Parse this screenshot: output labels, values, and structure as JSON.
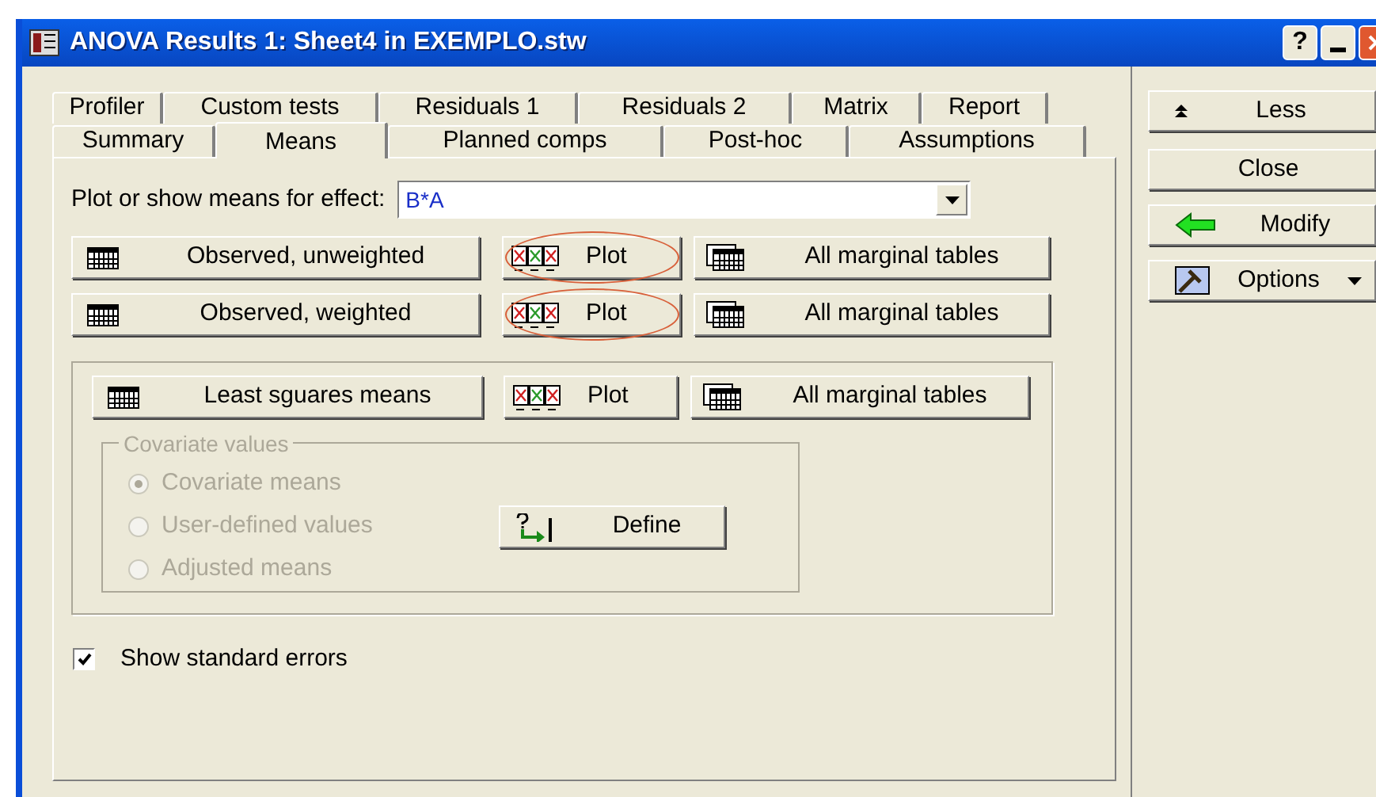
{
  "window": {
    "title": "ANOVA Results 1: Sheet4 in EXEMPLO.stw",
    "help_button": "?"
  },
  "tab_rows": [
    [
      {
        "label": "Profiler",
        "selected": false
      },
      {
        "label": "Custom tests",
        "selected": false
      },
      {
        "label": "Residuals 1",
        "selected": false
      },
      {
        "label": "Residuals 2",
        "selected": false
      },
      {
        "label": "Matrix",
        "selected": false
      },
      {
        "label": "Report",
        "selected": false
      }
    ],
    [
      {
        "label": "Summary",
        "selected": false
      },
      {
        "label": "Means",
        "selected": true
      },
      {
        "label": "Planned comps",
        "selected": false
      },
      {
        "label": "Post-hoc",
        "selected": false
      },
      {
        "label": "Assumptions",
        "selected": false
      }
    ]
  ],
  "effect": {
    "label": "Plot or show means for effect:",
    "value": "B*A"
  },
  "means_rows": [
    {
      "label": "Observed, unweighted",
      "plot": "Plot",
      "highlighted": true,
      "tables": "All marginal tables"
    },
    {
      "label": "Observed, weighted",
      "plot": "Plot",
      "highlighted": true,
      "tables": "All marginal tables"
    }
  ],
  "least_squares": {
    "label": "Least sguares means",
    "plot": "Plot",
    "tables": "All marginal tables"
  },
  "covariate": {
    "title": "Covariate values",
    "disabled": true,
    "define": "Define",
    "options": [
      {
        "label": "Covariate means",
        "selected": true
      },
      {
        "label": "User-defined values",
        "selected": false
      },
      {
        "label": "Adjusted means",
        "selected": false
      }
    ]
  },
  "show_standard_errors": {
    "label": "Show standard errors",
    "checked": true
  },
  "side_buttons": [
    {
      "kind": "less",
      "label": "Less"
    },
    {
      "kind": "plain",
      "label": "Close"
    },
    {
      "kind": "modify",
      "label": "Modify"
    },
    {
      "kind": "options",
      "label": "Options"
    }
  ]
}
